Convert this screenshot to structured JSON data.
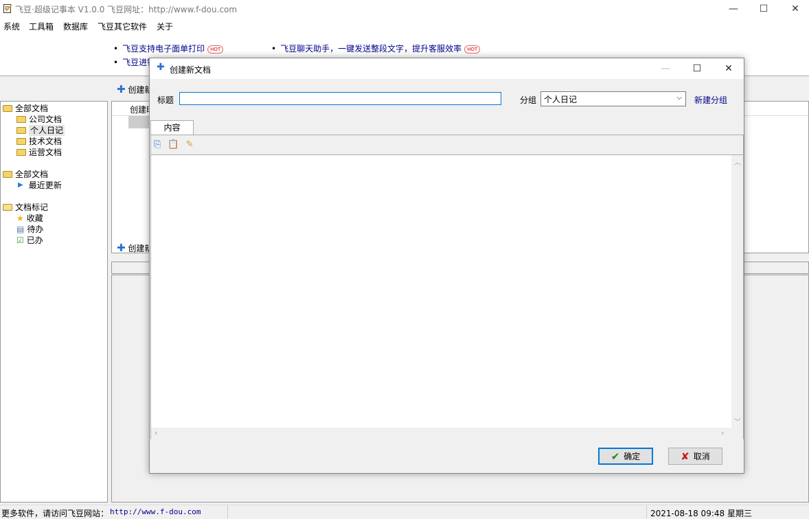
{
  "window": {
    "title": "飞豆·超级记事本 V1.0.0  飞豆网址：http://www.f-dou.com",
    "minimize": "—",
    "maximize": "☐",
    "close": "✕"
  },
  "menu": [
    "系统",
    "工具箱",
    "数据库",
    "飞豆其它软件",
    "关于"
  ],
  "banner": {
    "ad1": "飞豆支持电子面单打印",
    "ad2": "飞豆聊天助手，一键发送整段文字，提升客服效率",
    "ad3": "飞豆进销",
    "hot": "HOT"
  },
  "tree": {
    "group1": {
      "label": "全部文档",
      "items": [
        "公司文档",
        "个人日记",
        "技术文档",
        "运营文档"
      ]
    },
    "group2": {
      "label": "全部文档",
      "items": [
        "最近更新"
      ]
    },
    "group3": {
      "label": "文档标记",
      "items": [
        "收藏",
        "待办",
        "已办"
      ]
    }
  },
  "main": {
    "create_top": "创建新",
    "column_header": "创建时",
    "create_bottom": "创建新"
  },
  "status": {
    "left_label": "更多软件，请访问飞豆网站：",
    "left_link": "http://www.f-dou.com",
    "datetime": "2021-08-18 09:48 星期三"
  },
  "dialog": {
    "title": "创建新文档",
    "title_label": "标题",
    "title_value": "",
    "group_label": "分组",
    "group_value": "个人日记",
    "new_group": "新建分组",
    "tab_content": "内容",
    "ok": "确定",
    "cancel": "取消"
  }
}
